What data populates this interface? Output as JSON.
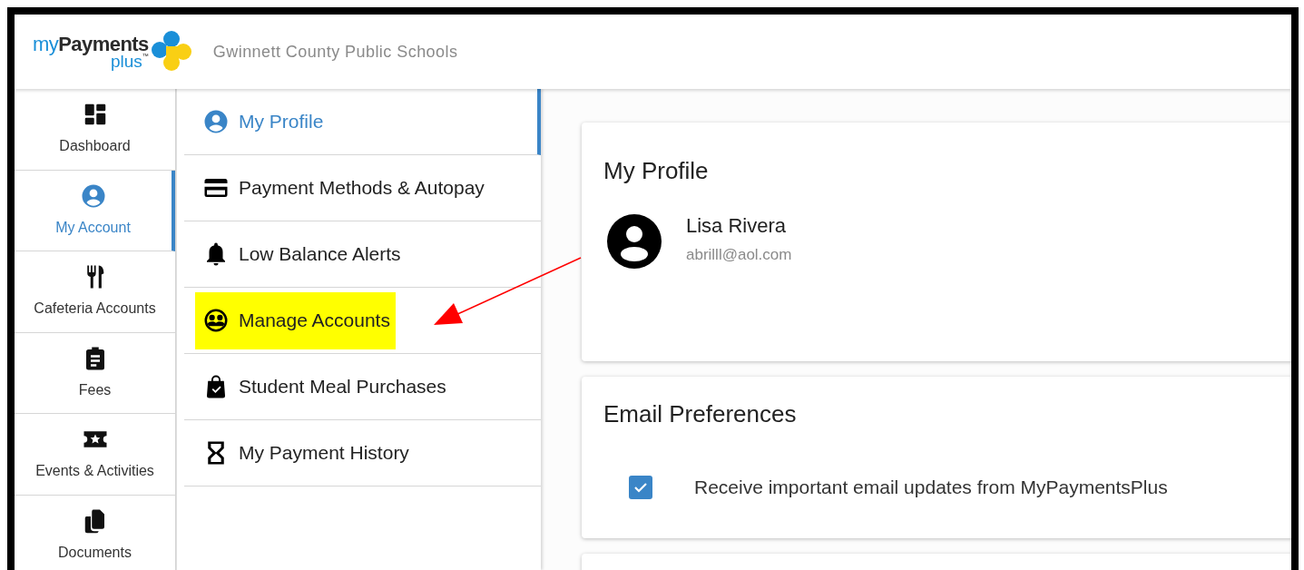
{
  "header": {
    "logo": {
      "prefix": "my",
      "name": "Payments",
      "suffix": "plus",
      "mark": "™"
    },
    "district": "Gwinnett County Public Schools"
  },
  "rail": {
    "items": [
      {
        "label": "Dashboard",
        "selected": false
      },
      {
        "label": "My Account",
        "selected": true
      },
      {
        "label": "Cafeteria Accounts",
        "selected": false
      },
      {
        "label": "Fees",
        "selected": false
      },
      {
        "label": "Events & Activities",
        "selected": false
      },
      {
        "label": "Documents",
        "selected": false
      }
    ]
  },
  "submenu": {
    "items": [
      {
        "label": "My Profile",
        "selected": true,
        "highlighted": false
      },
      {
        "label": "Payment Methods & Autopay",
        "selected": false,
        "highlighted": false
      },
      {
        "label": "Low Balance Alerts",
        "selected": false,
        "highlighted": false
      },
      {
        "label": "Manage Accounts",
        "selected": false,
        "highlighted": true
      },
      {
        "label": "Student Meal Purchases",
        "selected": false,
        "highlighted": false
      },
      {
        "label": "My Payment History",
        "selected": false,
        "highlighted": false
      }
    ]
  },
  "profile_card": {
    "title": "My Profile",
    "name": "Lisa Rivera",
    "email": "abrilll@aol.com"
  },
  "email_card": {
    "title": "Email Preferences",
    "options": [
      {
        "label": "Receive important email updates from MyPaymentsPlus",
        "checked": true
      }
    ]
  }
}
